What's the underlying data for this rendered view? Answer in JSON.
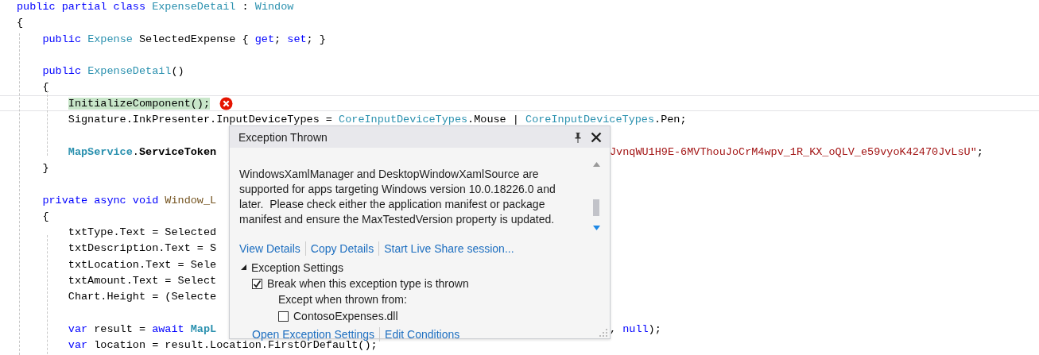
{
  "editor": {
    "lines": [
      {
        "tokens": [
          {
            "text": "public ",
            "kind": "keyword"
          },
          {
            "text": "partial ",
            "kind": "keyword"
          },
          {
            "text": "class ",
            "kind": "keyword"
          },
          {
            "text": "ExpenseDetail",
            "kind": "type"
          },
          {
            "text": " : ",
            "kind": "plain"
          },
          {
            "text": "Window",
            "kind": "type"
          }
        ]
      },
      {
        "tokens": [
          {
            "text": "{",
            "kind": "plain"
          }
        ]
      },
      {
        "tokens": [
          {
            "text": "    public ",
            "kind": "keyword"
          },
          {
            "text": "Expense ",
            "kind": "type"
          },
          {
            "text": "SelectedExpense { ",
            "kind": "plain"
          },
          {
            "text": "get",
            "kind": "keyword"
          },
          {
            "text": "; ",
            "kind": "plain"
          },
          {
            "text": "set",
            "kind": "keyword"
          },
          {
            "text": "; }",
            "kind": "plain"
          }
        ]
      },
      {
        "gap_before": true,
        "tokens": [
          {
            "text": "    public ",
            "kind": "keyword"
          },
          {
            "text": "ExpenseDetail",
            "kind": "type"
          },
          {
            "text": "()",
            "kind": "plain"
          }
        ]
      },
      {
        "tokens": [
          {
            "text": "    {",
            "kind": "plain"
          }
        ]
      },
      {
        "current": true,
        "error": true,
        "tokens": [
          {
            "text": "        InitializeComponent();",
            "kind": "highlighted"
          }
        ]
      },
      {
        "tokens": [
          {
            "text": "        Signature.InkPresenter.InputDeviceTypes = ",
            "kind": "plain"
          },
          {
            "text": "CoreInputDeviceTypes",
            "kind": "type"
          },
          {
            "text": ".Mouse | ",
            "kind": "plain"
          },
          {
            "text": "CoreInputDeviceTypes",
            "kind": "type"
          },
          {
            "text": ".Pen;",
            "kind": "plain"
          }
        ]
      },
      {
        "gap_before": true,
        "tokens": [
          {
            "text": "        MapService",
            "kind": "static"
          },
          {
            "text": ".",
            "kind": "plain"
          },
          {
            "text": "ServiceToken",
            "kind": "member"
          }
        ],
        "right_tokens": [
          {
            "text": "JvnqWU1H9E-6MVThouJoCrM4wpv_1R_KX_oQLV_e59vyoK42470JvLsU\"",
            "kind": "string"
          },
          {
            "text": ";",
            "kind": "plain"
          }
        ]
      },
      {
        "tokens": [
          {
            "text": "    }",
            "kind": "plain"
          }
        ]
      },
      {
        "gap_before": true,
        "tokens": [
          {
            "text": "    private ",
            "kind": "keyword"
          },
          {
            "text": "async ",
            "kind": "keyword"
          },
          {
            "text": "void ",
            "kind": "keyword"
          },
          {
            "text": "Window_L",
            "kind": "method"
          }
        ]
      },
      {
        "tokens": [
          {
            "text": "    {",
            "kind": "plain"
          }
        ]
      },
      {
        "tokens": [
          {
            "text": "        txtType.Text = Selected",
            "kind": "plain"
          }
        ]
      },
      {
        "tokens": [
          {
            "text": "        txtDescription.Text = S",
            "kind": "plain"
          }
        ]
      },
      {
        "tokens": [
          {
            "text": "        txtLocation.Text = Sele",
            "kind": "plain"
          }
        ]
      },
      {
        "tokens": [
          {
            "text": "        txtAmount.Text = Select",
            "kind": "plain"
          }
        ]
      },
      {
        "tokens": [
          {
            "text": "        Chart.Height = (Selecte",
            "kind": "plain"
          }
        ]
      },
      {
        "gap_before": true,
        "tokens": [
          {
            "text": "        var ",
            "kind": "keyword"
          },
          {
            "text": "result = ",
            "kind": "plain"
          },
          {
            "text": "await ",
            "kind": "keyword"
          },
          {
            "text": "MapL",
            "kind": "static"
          }
        ],
        "right_tokens": [
          {
            "text": ", ",
            "kind": "plain"
          },
          {
            "text": "null",
            "kind": "keyword"
          },
          {
            "text": ");",
            "kind": "plain"
          }
        ]
      },
      {
        "tokens": [
          {
            "text": "        var ",
            "kind": "keyword"
          },
          {
            "text": "location = result.Location.FirstOrDefault();",
            "kind": "plain"
          }
        ]
      }
    ]
  },
  "exception_popup": {
    "title": "Exception Thrown",
    "message": "WindowsXamlManager and DesktopWindowXamlSource are supported for apps targeting Windows version 10.0.18226.0 and later.  Please check either the application manifest or package manifest and ensure the MaxTestedVersion property is updated.",
    "links": [
      "View Details",
      "Copy Details",
      "Start Live Share session..."
    ],
    "settings": {
      "label": "Exception Settings",
      "expanded": true,
      "break_option": {
        "label": "Break when this exception type is thrown",
        "checked": true
      },
      "except_label": "Except when thrown from:",
      "modules": [
        {
          "label": "ContosoExpenses.dll",
          "checked": false
        }
      ]
    },
    "footer_links": [
      "Open Exception Settings",
      "Edit Conditions"
    ]
  }
}
